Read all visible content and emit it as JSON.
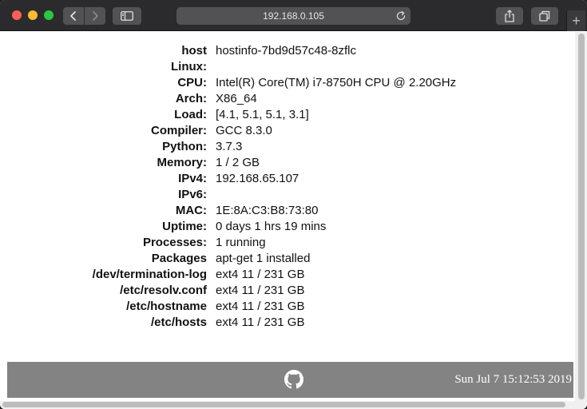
{
  "browser": {
    "url": "192.168.0.105",
    "new_tab_label": "+"
  },
  "info": [
    {
      "label": "host",
      "value": "hostinfo-7bd9d57c48-8zflc"
    },
    {
      "label": "Linux:",
      "value": ""
    },
    {
      "label": "CPU:",
      "value": "Intel(R) Core(TM) i7-8750H CPU @ 2.20GHz"
    },
    {
      "label": "Arch:",
      "value": "X86_64"
    },
    {
      "label": "Load:",
      "value": "[4.1, 5.1, 5.1, 3.1]"
    },
    {
      "label": "Compiler:",
      "value": "GCC 8.3.0"
    },
    {
      "label": "Python:",
      "value": "3.7.3"
    },
    {
      "label": "Memory:",
      "value": "1 / 2 GB"
    },
    {
      "label": "IPv4:",
      "value": "192.168.65.107"
    },
    {
      "label": "IPv6:",
      "value": ""
    },
    {
      "label": "MAC:",
      "value": "1E:8A:C3:B8:73:80"
    },
    {
      "label": "Uptime:",
      "value": "0 days 1 hrs 19 mins"
    },
    {
      "label": "Processes:",
      "value": "1 running"
    },
    {
      "label": "Packages",
      "value": "apt-get 1 installed"
    },
    {
      "label": "/dev/termination-log",
      "value": "ext4 11 / 231 GB"
    },
    {
      "label": "/etc/resolv.conf",
      "value": "ext4 11 / 231 GB"
    },
    {
      "label": "/etc/hostname",
      "value": "ext4 11 / 231 GB"
    },
    {
      "label": "/etc/hosts",
      "value": "ext4 11 / 231 GB"
    }
  ],
  "footer": {
    "icon": "github-icon",
    "timestamp": "Sun Jul 7 15:12:53 2019"
  },
  "colors": {
    "titlebar": "#2b2b2d",
    "footer": "#838383",
    "close": "#fe5f57",
    "minimize": "#febc2e",
    "maximize": "#28c840"
  }
}
